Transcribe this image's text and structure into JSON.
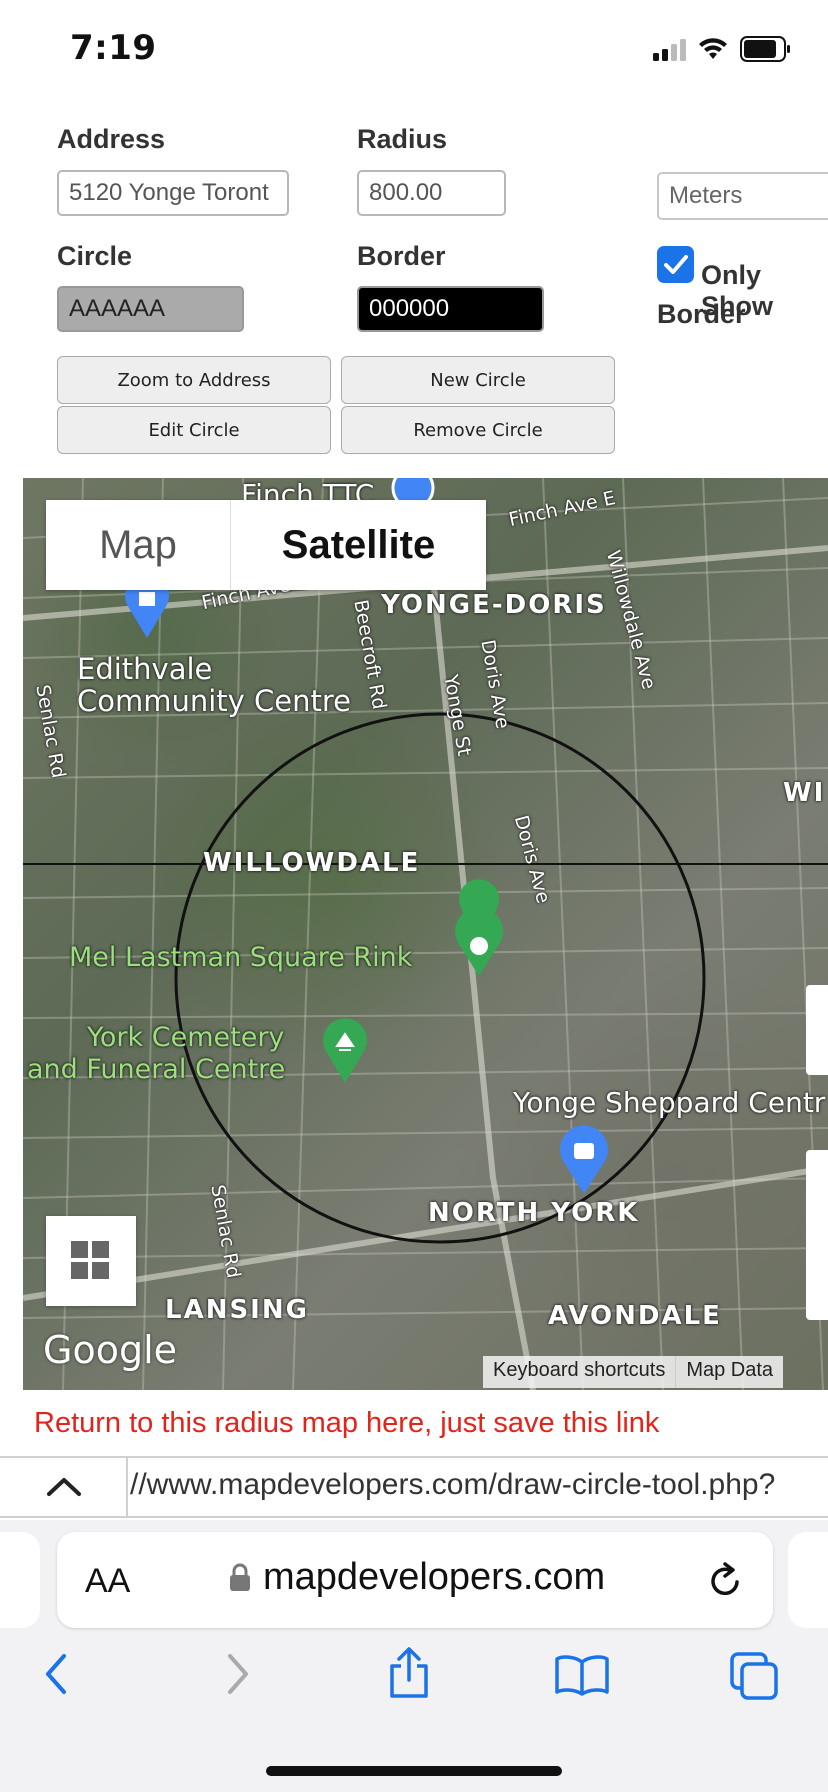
{
  "status": {
    "time": "7:19"
  },
  "form": {
    "address_label": "Address",
    "address_value": "5120 Yonge Toront",
    "radius_label": "Radius",
    "radius_value": "800.00",
    "unit_value": "Meters",
    "circle_label": "Circle",
    "circle_color_value": "AAAAAA",
    "circle_color": "#AAAAAA",
    "border_label": "Border",
    "border_color_value": "000000",
    "border_color": "#000000",
    "only_show_label": "Only Show",
    "border_only_label": "Border",
    "only_show_checked": true
  },
  "buttons": {
    "zoom": "Zoom to Address",
    "new_circle": "New Circle",
    "edit_circle": "Edit Circle",
    "remove_circle": "Remove Circle"
  },
  "map": {
    "tab_map": "Map",
    "tab_satellite": "Satellite",
    "active_tab": "Satellite",
    "labels": {
      "finch_ttc": "Finch TTC",
      "finch_ave_e": "Finch Ave E",
      "finch_ave": "Finch Ave",
      "willowdale_ave": "Willowdale Ave",
      "yonge_doris": "YONGE-DORIS",
      "edithvale_1": "Edithvale",
      "edithvale_2": "Community Centre",
      "beecroft": "Beecroft Rd",
      "doris_ave_1": "Doris Ave",
      "doris_ave_2": "Doris Ave",
      "yonge_st": "Yonge St",
      "senlac_1": "Senlac Rd",
      "senlac_2": "Senlac Rd",
      "willowdale": "WILLOWDALE",
      "wi_partial": "WI",
      "mel_lastman": "Mel Lastman Square Rink",
      "york_cemetery_1": "York Cemetery",
      "york_cemetery_2": "and Funeral Centre",
      "yonge_sheppard": "Yonge Sheppard Centr",
      "north_york": "NORTH YORK",
      "lansing": "LANSING",
      "avondale": "AVONDALE"
    },
    "google": "Google",
    "keyboard_shortcuts": "Keyboard shortcuts",
    "map_data": "Map Data"
  },
  "save_link_text": "Return to this radius map here, just save this link",
  "url_field": "//www.mapdevelopers.com/draw-circle-tool.php?",
  "safari": {
    "aa": "AA",
    "domain": "mapdevelopers.com"
  },
  "icons": [
    "signal-icon",
    "wifi-icon",
    "battery-icon",
    "check-icon",
    "grid-icon",
    "chevron-up-icon",
    "lock-icon",
    "reload-icon",
    "back-icon",
    "forward-icon",
    "share-icon",
    "bookmarks-icon",
    "tabs-icon",
    "pin-icon"
  ],
  "colors": {
    "accent": "#1a73e8",
    "link_red": "#e3241b",
    "pin_green": "#34a853",
    "pin_blue": "#4285f4"
  }
}
